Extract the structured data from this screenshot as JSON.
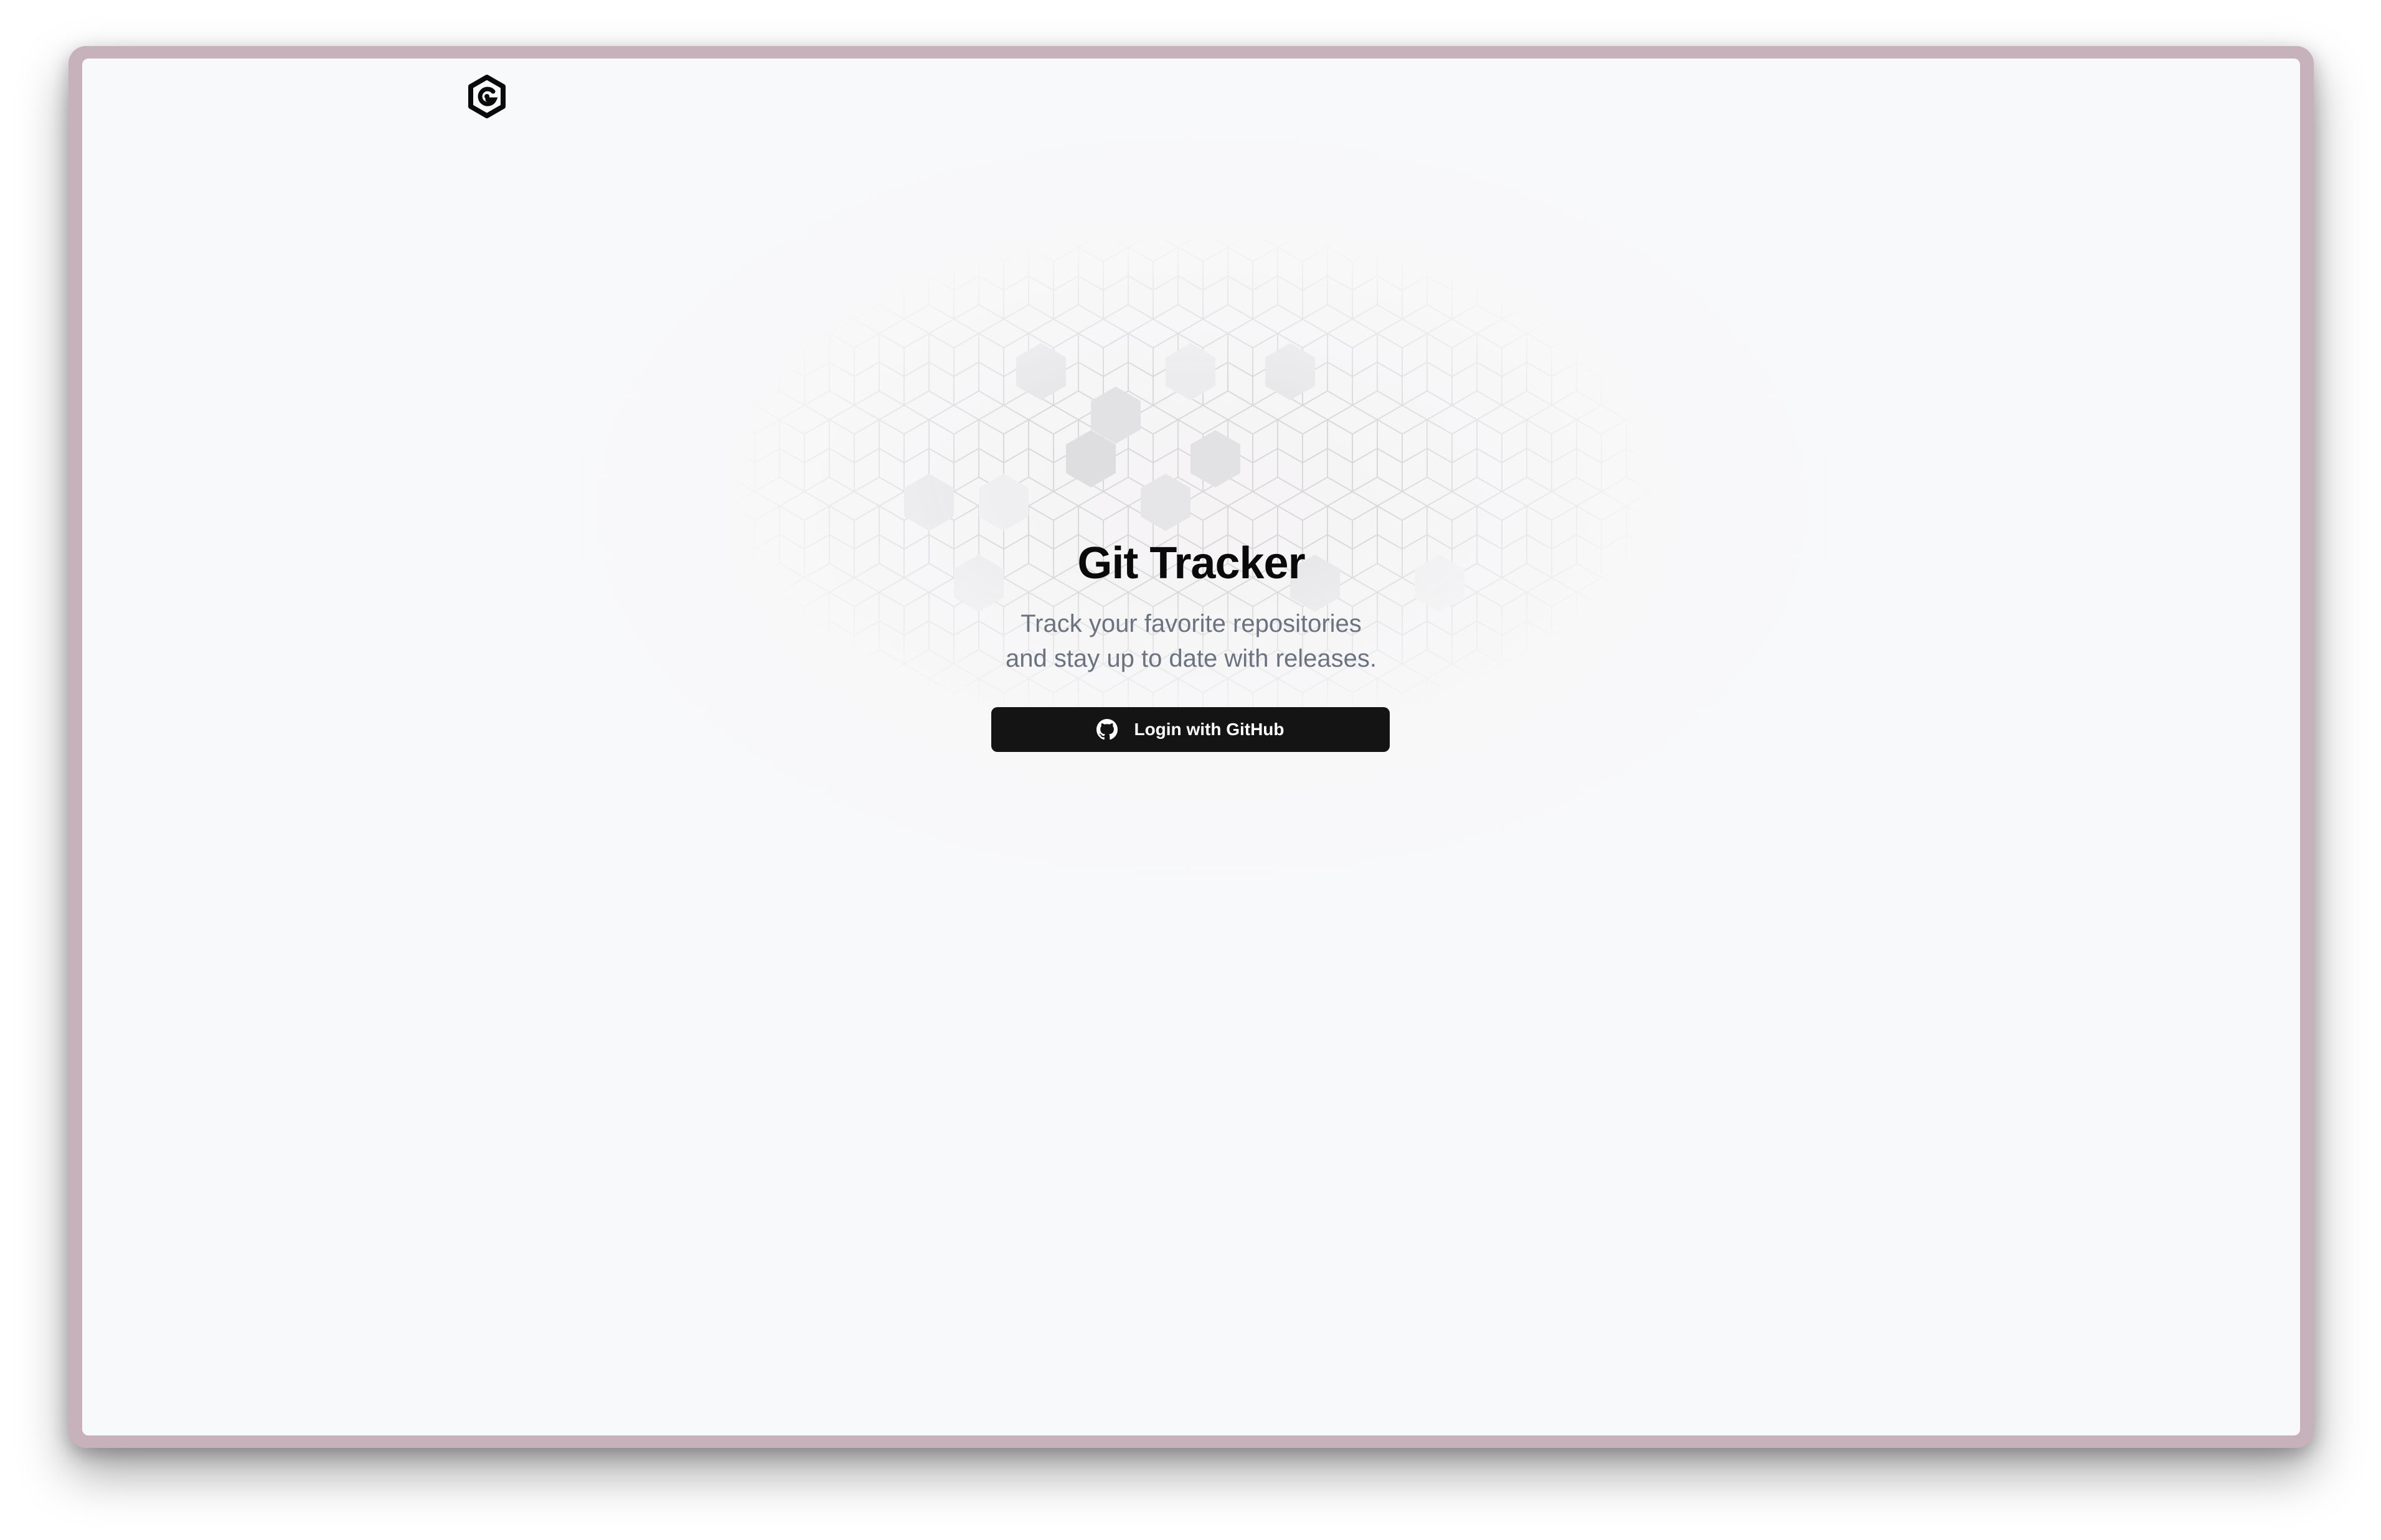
{
  "app": {
    "logo_icon": "git-tracker-hexagon-logo-icon"
  },
  "hero": {
    "title": "Git Tracker",
    "subtitle_line1": "Track your favorite repositories",
    "subtitle_line2": "and stay up to date with releases.",
    "login_button_label": "Login with GitHub",
    "login_button_icon": "github-icon"
  },
  "colors": {
    "window_frame": "#c7b2bb",
    "background": "#f8f9fa",
    "title_text": "#0a0a0a",
    "subtitle_text": "#6b7280",
    "button_bg": "#141414",
    "button_text": "#ffffff"
  }
}
